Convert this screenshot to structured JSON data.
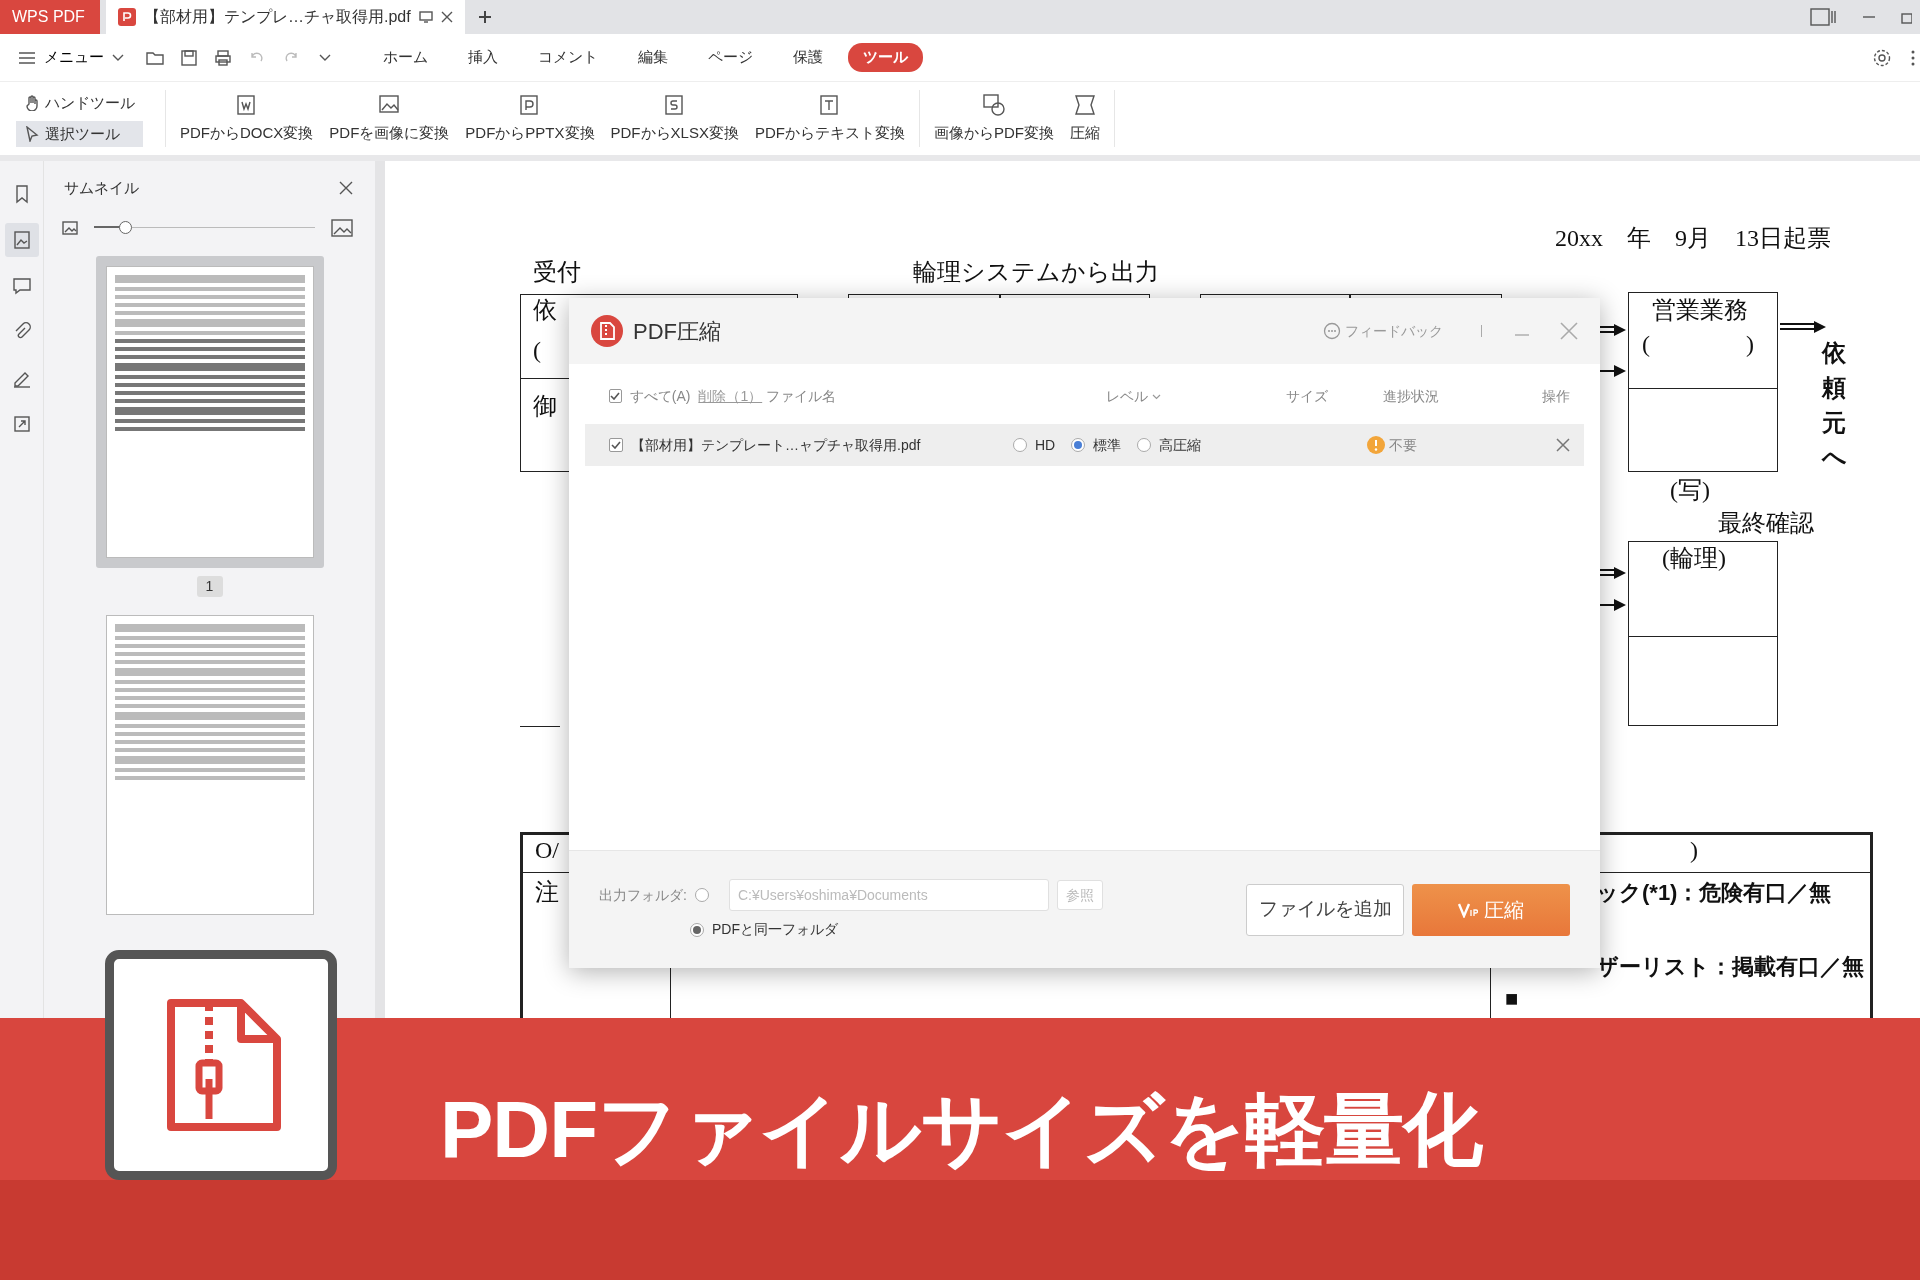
{
  "app_tabs": [
    {
      "label": "WPS PDF",
      "kind": "app",
      "selected": false
    },
    {
      "label": "【部材用】テンプレ…チャ取得用.pdf",
      "kind": "document",
      "selected": true
    }
  ],
  "menu": {
    "label": "メニュー"
  },
  "ribbon_tabs": [
    {
      "label": "ホーム",
      "selected": false
    },
    {
      "label": "挿入",
      "selected": false
    },
    {
      "label": "コメント",
      "selected": false
    },
    {
      "label": "編集",
      "selected": false
    },
    {
      "label": "ページ",
      "selected": false
    },
    {
      "label": "保護",
      "selected": false
    },
    {
      "label": "ツール",
      "selected": true
    }
  ],
  "tool_modes": [
    {
      "label": "ハンドツール",
      "selected": false
    },
    {
      "label": "選択ツール",
      "selected": true
    }
  ],
  "tools": [
    {
      "label": "PDFからDOCX変換"
    },
    {
      "label": "PDFを画像に変換"
    },
    {
      "label": "PDFからPPTX変換"
    },
    {
      "label": "PDFからXLSX変換"
    },
    {
      "label": "PDFからテキスト変換"
    },
    {
      "label": "画像からPDF変換"
    },
    {
      "label": "圧縮"
    }
  ],
  "side_icons": [
    {
      "selected": false
    },
    {
      "selected": true
    },
    {
      "selected": false
    },
    {
      "selected": false
    },
    {
      "selected": false
    },
    {
      "selected": false
    }
  ],
  "thumbnail_panel": {
    "title": "サムネイル",
    "zoom": {
      "level": 0.14
    },
    "pages": [
      {
        "label": "1",
        "selected": true
      },
      {
        "selected": false
      }
    ]
  },
  "document": {
    "date": "20xx　年　9月　13日起票",
    "reception": "受付",
    "system_output": "輪理システムから出力",
    "left_box": [
      "依",
      "(",
      "御"
    ],
    "sales_box": {
      "title": "営業業務",
      "paren": "(　　　　)"
    },
    "copy_note": "(写)",
    "final_check": "最終確認",
    "check_box": "(輪理)",
    "to_requester": "依頼元へ",
    "table": {
      "row1": [
        "O/",
        ")"
      ],
      "row2_label": "注",
      "checks": [
        "ック(*1)：危険有口／無",
        "ザーリスト：掲載有口／無"
      ],
      "mark": "■"
    }
  },
  "dialog": {
    "title": "PDF圧縮",
    "feedback": "フィードバック",
    "select_all": {
      "label": "すべて(A)",
      "checked": true
    },
    "delete": "削除（1）",
    "columns": [
      "ファイル名",
      "レベル",
      "サイズ",
      "進捗状況",
      "操作"
    ],
    "files": [
      {
        "checked": true,
        "name": "【部材用】テンプレート…ャプチャ取得用.pdf",
        "levels": [
          {
            "label": "HD",
            "selected": false
          },
          {
            "label": "標準",
            "selected": true
          },
          {
            "label": "高圧縮",
            "selected": false
          }
        ],
        "status": "不要"
      }
    ],
    "output": {
      "label": "出力フォルダ:",
      "custom": {
        "selected": false,
        "path": "C:¥Users¥oshima¥Documents",
        "browse": "参照"
      },
      "same_folder": {
        "selected": true,
        "label": "PDFと同一フォルダ"
      }
    },
    "add_button": "ファイルを追加",
    "compress_button": "圧縮"
  },
  "banner": {
    "title": "PDFファイルサイズを軽量化"
  }
}
